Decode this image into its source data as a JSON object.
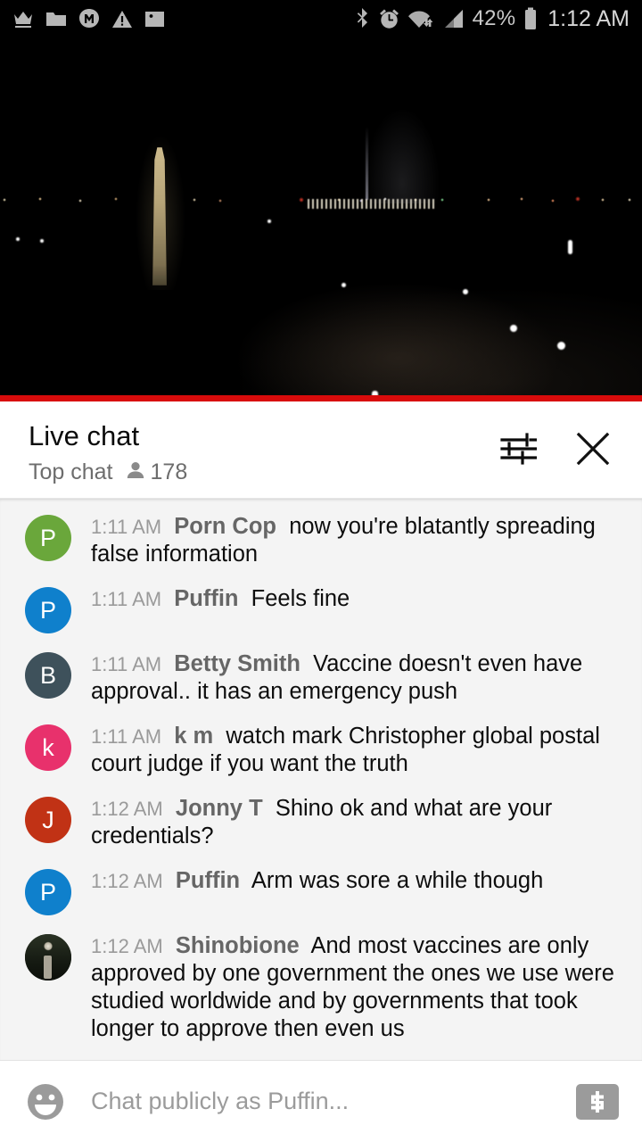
{
  "status_bar": {
    "icons_left": [
      "crown-icon",
      "folder-icon",
      "messenger-icon",
      "warning-icon",
      "photo-icon"
    ],
    "icons_right": [
      "bluetooth-icon",
      "alarm-icon",
      "wifi-icon",
      "cellular-signal-icon",
      "battery-icon"
    ],
    "battery_percent": "42%",
    "clock": "1:12 AM"
  },
  "video": {
    "scene": "washington-monument-night-stream",
    "progress_color": "#d80b0b"
  },
  "chat_header": {
    "title": "Live chat",
    "mode": "Top chat",
    "viewer_icon": "person-icon",
    "viewer_count": "178",
    "settings_icon": "tune-sliders-icon",
    "close_icon": "close-icon"
  },
  "messages": [
    {
      "time": "1:11 AM",
      "author": "Porn Cop",
      "text": "now you're blatantly spreading false information",
      "avatar_letter": "P",
      "avatar_color": "#6aa73b",
      "avatar_type": "letter"
    },
    {
      "time": "1:11 AM",
      "author": "Puffin",
      "text": "Feels fine",
      "avatar_letter": "P",
      "avatar_color": "#0f80cc",
      "avatar_type": "letter"
    },
    {
      "time": "1:11 AM",
      "author": "Betty Smith",
      "text": "Vaccine doesn't even have approval.. it has an emergency push",
      "avatar_letter": "B",
      "avatar_color": "#3e515b",
      "avatar_type": "letter"
    },
    {
      "time": "1:11 AM",
      "author": "k m",
      "text": "watch mark Christopher global postal court judge if you want the truth",
      "avatar_letter": "k",
      "avatar_color": "#e8316c",
      "avatar_type": "letter"
    },
    {
      "time": "1:12 AM",
      "author": "Jonny T",
      "text": "Shino ok and what are your credentials?",
      "avatar_letter": "J",
      "avatar_color": "#c13215",
      "avatar_type": "letter"
    },
    {
      "time": "1:12 AM",
      "author": "Puffin",
      "text": "Arm was sore a while though",
      "avatar_letter": "P",
      "avatar_color": "#0f80cc",
      "avatar_type": "letter"
    },
    {
      "time": "1:12 AM",
      "author": "Shinobione",
      "text": "And most vaccines are only approved by one government the ones we use were studied worldwide and by governments that took longer to approve then even us",
      "avatar_letter": "",
      "avatar_color": "#1b2016",
      "avatar_type": "photo"
    }
  ],
  "chat_input": {
    "emoji_icon": "emoji-smiley-icon",
    "placeholder": "Chat publicly as Puffin...",
    "superchat_icon": "dollar-superchat-icon"
  }
}
